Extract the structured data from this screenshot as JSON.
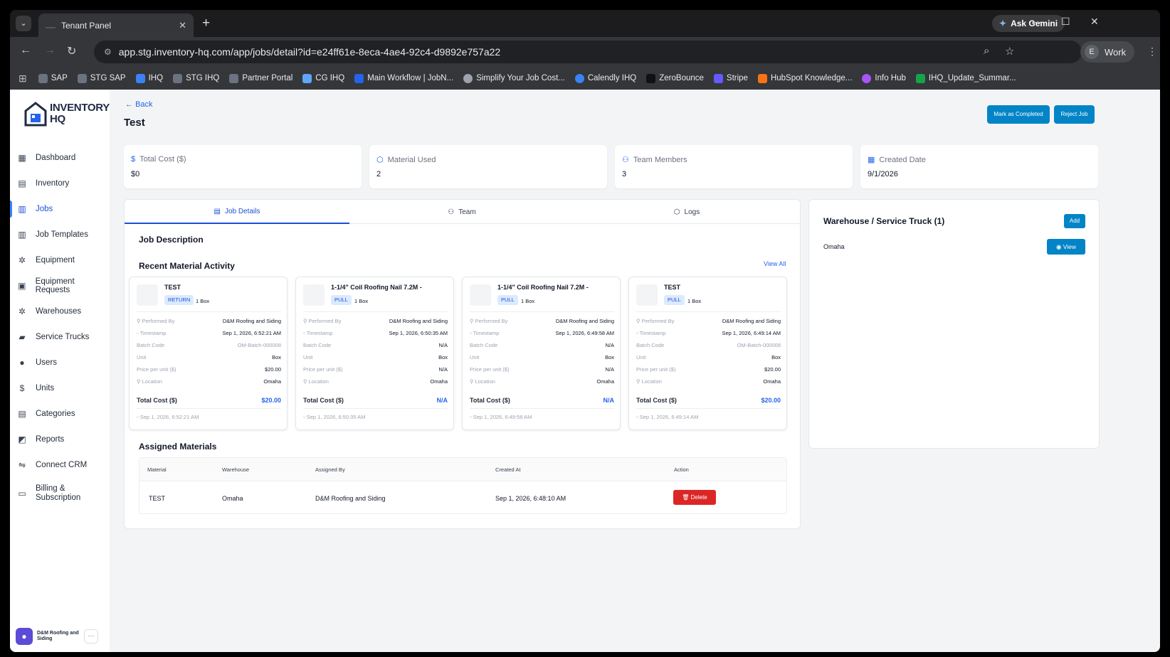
{
  "browser": {
    "tab_title": "Tenant Panel",
    "url": "app.stg.inventory-hq.com/app/jobs/detail?id=e24ff61e-8eca-4ae4-92c4-d9892e757a22",
    "gemini_label": "Ask Gemini",
    "profile_initial": "E",
    "profile_label": "Work",
    "bookmarks": [
      "SAP",
      "STG SAP",
      "IHQ",
      "STG IHQ",
      "Partner Portal",
      "CG IHQ",
      "Main Workflow | JobN...",
      "Simplify Your Job Cost...",
      "Calendly IHQ",
      "ZeroBounce",
      "Stripe",
      "HubSpot Knowledge...",
      "Info Hub",
      "IHQ_Update_Summar..."
    ]
  },
  "logo": {
    "line1": "INVENTORY",
    "line2": "HQ"
  },
  "sidebar": {
    "items": [
      "Dashboard",
      "Inventory",
      "Jobs",
      "Job Templates",
      "Equipment",
      "Equipment Requests",
      "Warehouses",
      "Service Trucks",
      "Users",
      "Units",
      "Categories",
      "Reports",
      "Connect CRM",
      "Billing & Subscription"
    ],
    "active": "Jobs",
    "org_name": "D&M Roofing and Siding"
  },
  "header": {
    "back_label": "Back",
    "title": "Test",
    "mark_completed_label": "Mark as Completed",
    "reject_label": "Reject Job"
  },
  "stats": [
    {
      "label": "Total Cost ($)",
      "value": "$0"
    },
    {
      "label": "Material Used",
      "value": "2"
    },
    {
      "label": "Team Members",
      "value": "3"
    },
    {
      "label": "Created Date",
      "value": "9/1/2026"
    }
  ],
  "tabs": [
    "Job Details",
    "Team",
    "Logs"
  ],
  "job": {
    "description_heading": "Job Description",
    "recent_heading": "Recent Material Activity",
    "view_all": "View All",
    "labels": {
      "performed_by": "Performed By",
      "timestamp": "Timestamp",
      "batch_code": "Batch Code",
      "unit": "Unit",
      "price": "Price per unit ($)",
      "location": "Location",
      "total": "Total Cost ($)"
    },
    "activity": [
      {
        "name": "TEST",
        "type": "RETURN",
        "qty": "1 Box",
        "performed_by": "D&M Roofing and Siding",
        "timestamp": "Sep 1, 2026, 6:52:21 AM",
        "batch": "OM-Batch-000008",
        "unit": "Box",
        "price": "$20.00",
        "location": "Omaha",
        "total": "$20.00",
        "footer": "Sep 1, 2026, 6:52:21 AM"
      },
      {
        "name": "1-1/4\" Coil Roofing Nail 7.2M -",
        "type": "PULL",
        "qty": "1 Box",
        "performed_by": "D&M Roofing and Siding",
        "timestamp": "Sep 1, 2026, 6:50:35 AM",
        "batch": "N/A",
        "unit": "Box",
        "price": "N/A",
        "location": "Omaha",
        "total": "N/A",
        "footer": "Sep 1, 2026, 6:50:35 AM"
      },
      {
        "name": "1-1/4\" Coil Roofing Nail 7.2M -",
        "type": "PULL",
        "qty": "1 Box",
        "performed_by": "D&M Roofing and Siding",
        "timestamp": "Sep 1, 2026, 6:49:58 AM",
        "batch": "N/A",
        "unit": "Box",
        "price": "N/A",
        "location": "Omaha",
        "total": "N/A",
        "footer": "Sep 1, 2026, 6:49:58 AM"
      },
      {
        "name": "TEST",
        "type": "PULL",
        "qty": "1 Box",
        "performed_by": "D&M Roofing and Siding",
        "timestamp": "Sep 1, 2026, 6:49:14 AM",
        "batch": "OM-Batch-000008",
        "unit": "Box",
        "price": "$20.00",
        "location": "Omaha",
        "total": "$20.00",
        "footer": "Sep 1, 2026, 6:49:14 AM"
      }
    ],
    "assigned_heading": "Assigned Materials",
    "table_headers": [
      "Material",
      "Warehouse",
      "Assigned By",
      "Created At",
      "Action"
    ],
    "table_row": {
      "material": "TEST",
      "warehouse": "Omaha",
      "assigned_by": "D&M Roofing and Siding",
      "created_at": "Sep 1, 2026, 6:48:10 AM",
      "action": "Delete"
    }
  },
  "warehouse": {
    "title": "Warehouse / Service Truck (1)",
    "add_label": "Add",
    "name": "Omaha",
    "view_label": "View"
  }
}
